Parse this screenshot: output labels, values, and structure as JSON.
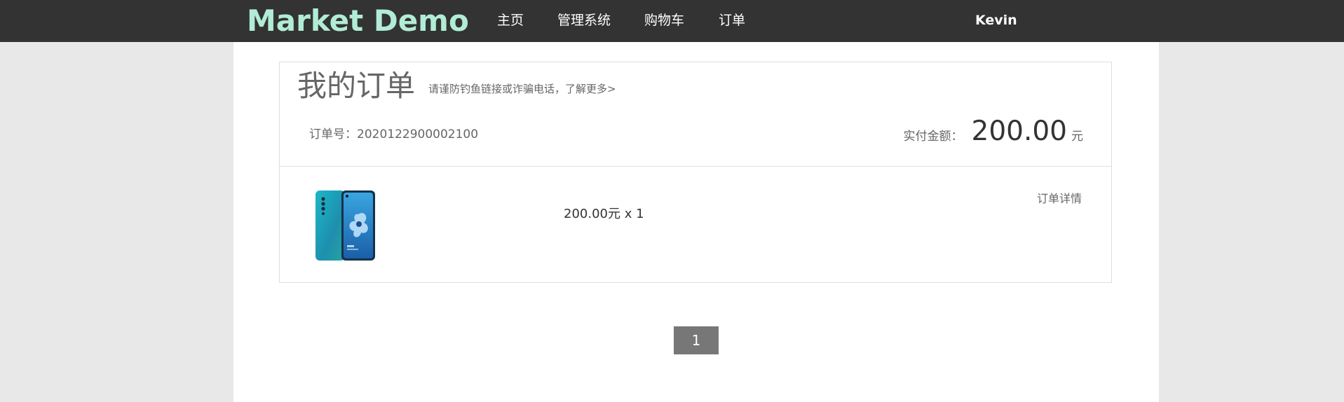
{
  "navbar": {
    "brand": "Market Demo",
    "items": [
      {
        "label": "主页"
      },
      {
        "label": "管理系统"
      },
      {
        "label": "购物车"
      },
      {
        "label": "订单"
      }
    ],
    "user": "Kevin",
    "colors": {
      "background": "#333333",
      "brand": "#b2ecd6",
      "text": "#ffffff"
    }
  },
  "order_page": {
    "title": "我的订单",
    "fraud_notice": "请谨防钓鱼链接或诈骗电话，了解更多>",
    "order": {
      "number_label": "订单号：",
      "number": "2020122900002100",
      "paid_label": "实付金额：",
      "paid_amount": "200.00",
      "paid_unit": "元",
      "item": {
        "image_icon": "phone-product-image",
        "price_qty": "200.00元 x 1"
      },
      "detail_link": "订单详情"
    }
  },
  "pagination": {
    "current_page": "1"
  }
}
